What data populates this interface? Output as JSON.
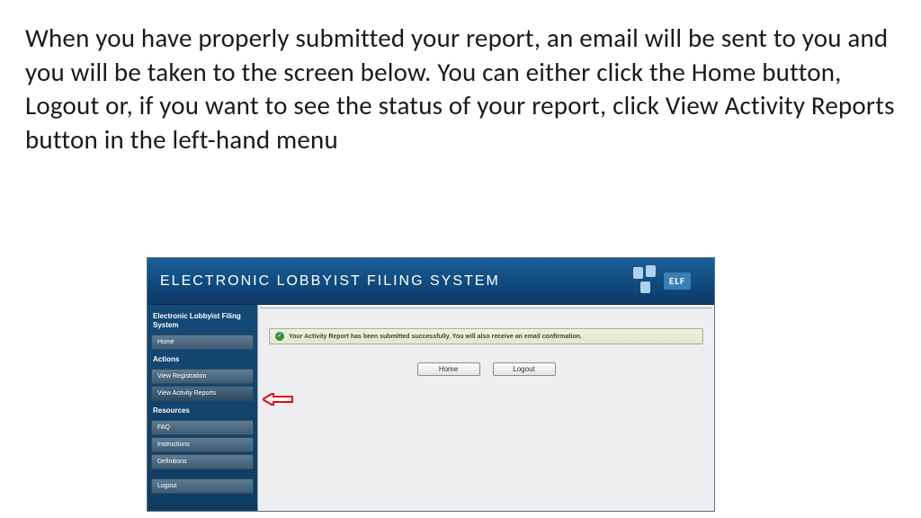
{
  "instruction_text": "When you have properly submitted your report, an email will be sent to you and you will be taken to the screen below.  You can either click the Home button, Logout or, if you want to see the status of your report, click View Activity Reports button in the left-hand menu",
  "header": {
    "title": "ELECTRONIC LOBBYIST FILING SYSTEM",
    "logo_text": "ELF"
  },
  "sidebar": {
    "section1_title": "Electronic Lobbyist Filing System",
    "home": "Home",
    "section2_title": "Actions",
    "view_registration": "View Registration",
    "view_activity_reports": "View Activity Reports",
    "section3_title": "Resources",
    "faq": "FAQ",
    "instructions": "Instructions",
    "definitions": "Definitions",
    "logout": "Logout"
  },
  "main": {
    "success_message": "Your Activity Report has been submitted successfully. You will also receive an email confirmation.",
    "home_button": "Home",
    "logout_button": "Logout"
  }
}
